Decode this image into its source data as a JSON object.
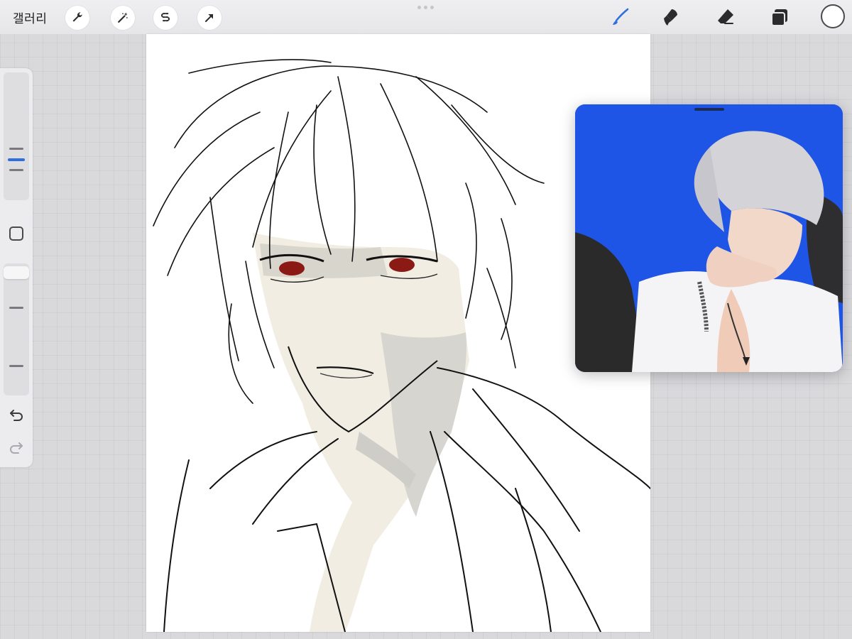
{
  "app": {
    "gallery_label": "갤러리"
  },
  "toolbar": {
    "left_tools": [
      {
        "icon": "wrench-icon"
      },
      {
        "icon": "magic-wand-icon"
      },
      {
        "icon": "selection-icon"
      },
      {
        "icon": "transform-arrow-icon"
      }
    ],
    "right_tools": [
      {
        "icon": "brush-icon",
        "active": true
      },
      {
        "icon": "smudge-icon"
      },
      {
        "icon": "eraser-icon"
      },
      {
        "icon": "layers-icon"
      }
    ],
    "active_color": "#ffffff",
    "accent_color": "#2f6fe0"
  },
  "sidebar": {
    "brush_size_level": 0.25,
    "opacity_level": 0.05,
    "icons": [
      "modify-button-icon",
      "undo-icon",
      "redo-icon"
    ]
  },
  "reference": {
    "background_color": "#1f55e6"
  }
}
